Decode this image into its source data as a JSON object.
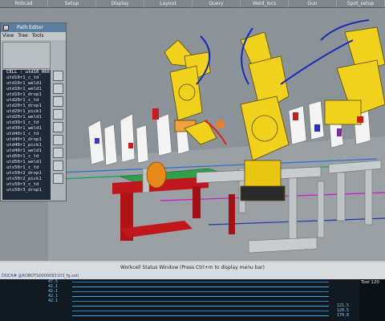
{
  "menu": {
    "items": [
      "Robcad",
      "Setup",
      "Display",
      "Layout",
      "Query",
      "Weld_locs",
      "Gun",
      "Spot_setup"
    ]
  },
  "path_editor": {
    "title": "Path Editor",
    "menu": [
      "View",
      "Tree",
      "Tools"
    ],
    "rows": [
      "CELL : utd10_060",
      "utd10r1_c_td",
      "utd10r1_weld1",
      "utd10r1_weld1",
      "utd10r1_drop1",
      "utd20r1_c_td",
      "utd20r1_drop1",
      "utd20r1_pick1",
      "utd20r1_weld1",
      "utd30r1_c_td",
      "utd30r1_weld1",
      "utd40r1_c_td",
      "utd40r1_drop1",
      "utd40r1_pick1",
      "utd40r1_weld1",
      "utd50r1_c_td",
      "utd50r1_weld1",
      "uts50r1_c_td",
      "uts50r2_drop1",
      "uts50r2_pick1",
      "uts50r3_c_td",
      "uts50r3_drop1"
    ]
  },
  "status_window": {
    "title": "Workcell Status Window  (Press Ctrl+m to display menu bar)",
    "subtitle": "DOCR# @ROBOTS0000082103_fg.sol)",
    "right_label": "Tool  120",
    "numbers": [
      "47.5",
      "42.1",
      "42.1",
      "42.1",
      "42.1",
      "121.5",
      "120.5",
      "170.8"
    ]
  },
  "colors": {
    "robot_yellow": "#f0d21c",
    "fixture_red": "#c0171c",
    "fixture_grey": "#b8b8b8",
    "panel_blue": "#5c7f9f"
  }
}
